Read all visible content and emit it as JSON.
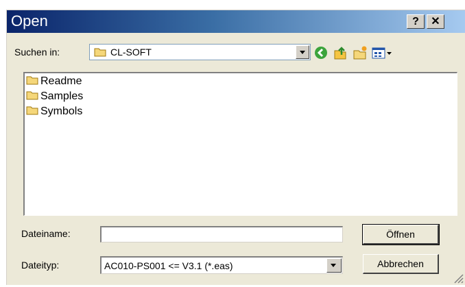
{
  "window": {
    "title": "Open",
    "help_label": "?",
    "close_label": "✕"
  },
  "lookin": {
    "label": "Suchen in:",
    "value": "CL-SOFT"
  },
  "toolbar": {
    "icons": [
      "back-icon",
      "up-folder-icon",
      "new-folder-icon",
      "view-menu-icon"
    ]
  },
  "files": [
    {
      "name": "Readme"
    },
    {
      "name": "Samples"
    },
    {
      "name": "Symbols"
    }
  ],
  "filename": {
    "label": "Dateiname:",
    "value": ""
  },
  "filetype": {
    "label": "Dateityp:",
    "value": "AC010-PS001 <= V3.1 (*.eas)"
  },
  "buttons": {
    "open": "Öffnen",
    "cancel": "Abbrechen"
  }
}
